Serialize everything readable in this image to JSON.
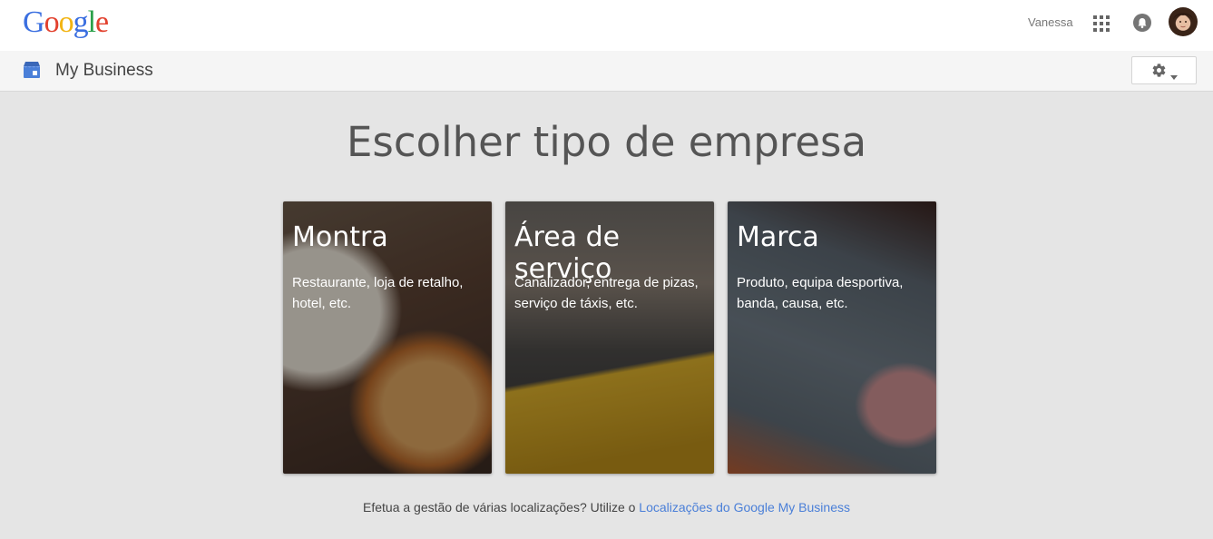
{
  "brand": {
    "logo_letters": [
      {
        "char": "G",
        "color": "#3b6fe0"
      },
      {
        "char": "o",
        "color": "#e2412e"
      },
      {
        "char": "o",
        "color": "#f2b413"
      },
      {
        "char": "g",
        "color": "#3b6fe0"
      },
      {
        "char": "l",
        "color": "#2ba14b"
      },
      {
        "char": "e",
        "color": "#e2412e"
      }
    ]
  },
  "header": {
    "user_name": "Vanessa",
    "apps_icon": "apps-grid-icon",
    "notifications_icon": "bell-icon",
    "avatar": "user-avatar"
  },
  "subheader": {
    "app_title": "My Business",
    "app_icon": "my-business-icon",
    "settings_icon": "gear-icon"
  },
  "main": {
    "heading": "Escolher tipo de empresa",
    "cards": [
      {
        "title": "Montra",
        "description": "Restaurante, loja de retalho, hotel, etc."
      },
      {
        "title": "Área de serviço",
        "description": "Canalizador, entrega de pizas, serviço de táxis, etc."
      },
      {
        "title": "Marca",
        "description": "Produto, equipa desportiva, banda, causa, etc."
      }
    ]
  },
  "footer": {
    "text": "Efetua a gestão de várias localizações? Utilize o ",
    "link_text": "Localizações do Google My Business"
  },
  "colors": {
    "page_bg": "#e5e5e5",
    "link": "#4a7fd8",
    "card_text": "#ffffff"
  }
}
